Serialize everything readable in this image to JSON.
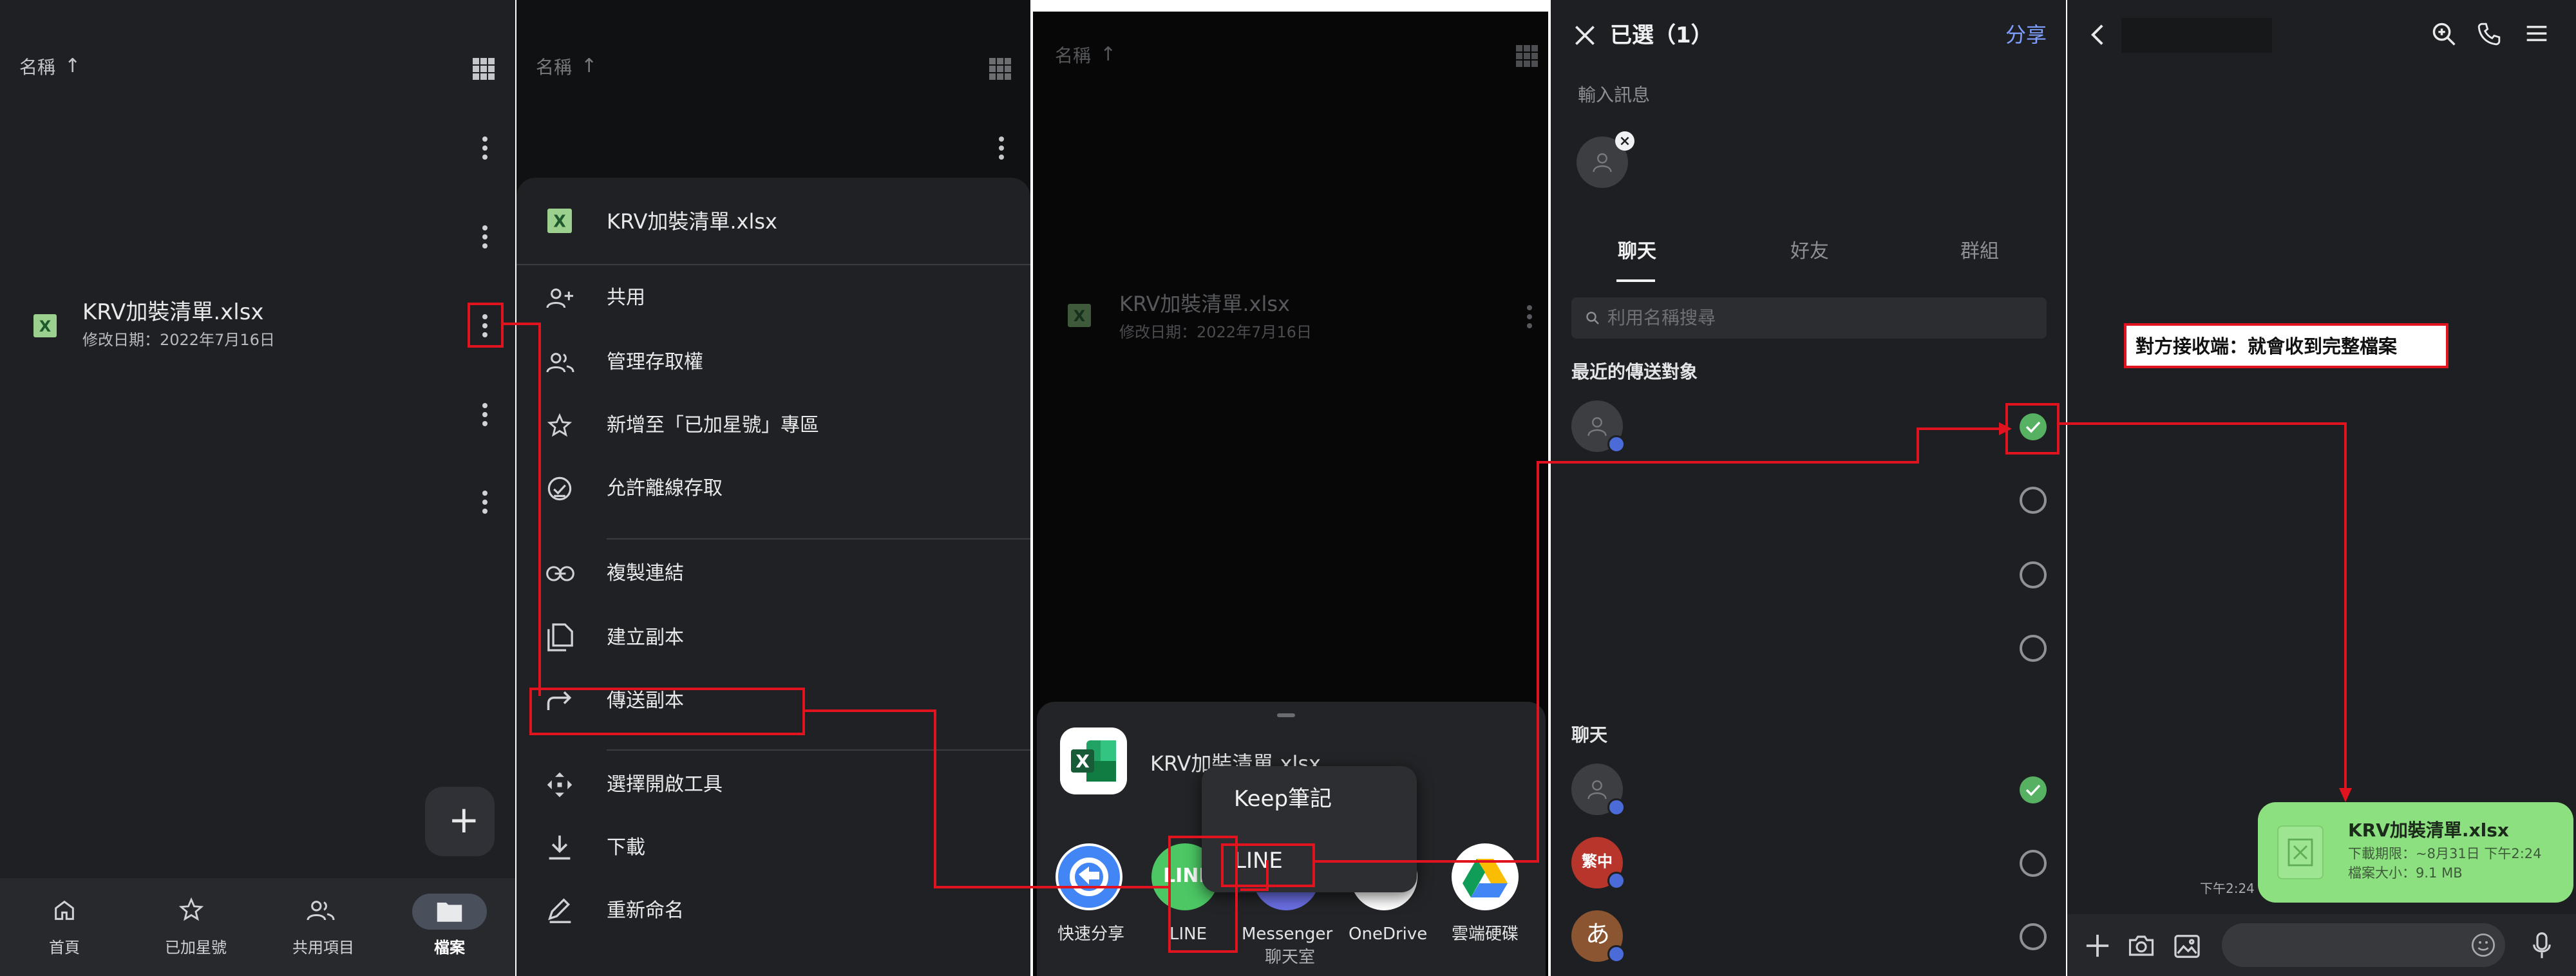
{
  "panel1": {
    "sort_label": "名稱",
    "file_name": "KRV加裝清單.xlsx",
    "file_meta": "修改日期：2022年7月16日",
    "fab_label": "+",
    "nav": [
      {
        "label": "首頁",
        "icon": "home-icon"
      },
      {
        "label": "已加星號",
        "icon": "star-icon"
      },
      {
        "label": "共用項目",
        "icon": "people-icon"
      },
      {
        "label": "檔案",
        "icon": "folder-icon"
      }
    ]
  },
  "panel2": {
    "sort_label": "名稱",
    "sheet_file_name": "KRV加裝清單.xlsx",
    "menu": [
      {
        "label": "共用",
        "icon": "person-add-icon"
      },
      {
        "label": "管理存取權",
        "icon": "people-icon"
      },
      {
        "label": "新增至「已加星號」專區",
        "icon": "star-icon"
      },
      {
        "label": "允許離線存取",
        "icon": "offline-check-icon"
      },
      {
        "label": "複製連結",
        "icon": "link-icon"
      },
      {
        "label": "建立副本",
        "icon": "copy-icon"
      },
      {
        "label": "傳送副本",
        "icon": "share-arrow-icon"
      },
      {
        "label": "選擇開啟工具",
        "icon": "open-with-icon"
      },
      {
        "label": "下載",
        "icon": "download-icon"
      },
      {
        "label": "重新命名",
        "icon": "rename-icon"
      }
    ]
  },
  "panel3": {
    "sort_label": "名稱",
    "file_name": "KRV加裝清單.xlsx",
    "file_meta": "修改日期：2022年7月16日",
    "sheet_file_name": "KRV加裝清單.xlsx",
    "popup_items": [
      "Keep筆記",
      "LINE"
    ],
    "apps": [
      {
        "label": "快速分享",
        "label2": ""
      },
      {
        "label": "LINE",
        "label2": ""
      },
      {
        "label": "Messenger",
        "label2": "聊天室"
      },
      {
        "label": "OneDrive",
        "label2": ""
      },
      {
        "label": "雲端硬碟",
        "label2": ""
      }
    ]
  },
  "panel4": {
    "title": "已選（1）",
    "share_label": "分享",
    "message_placeholder": "輸入訊息",
    "tabs": [
      "聊天",
      "好友",
      "群組"
    ],
    "search_placeholder": "利用名稱搜尋",
    "recent_header": "最近的傳送對象",
    "chats_header": "聊天",
    "avatar_texts": [
      "繁中",
      "あ"
    ]
  },
  "panel5": {
    "annotation": "對方接收端：就會收到完整檔案",
    "file_name": "KRV加裝清單.xlsx",
    "file_expiry": "下載期限：~8月31日 下午2:24",
    "file_size": "檔案大小：9.1 MB",
    "message_time": "下午2:24"
  },
  "colors": {
    "accent_red": "#e0131e",
    "line_green": "#57b162",
    "chat_bubble": "#8de07f",
    "share_blue": "#7e9fff",
    "excel_green": "#107c41"
  }
}
